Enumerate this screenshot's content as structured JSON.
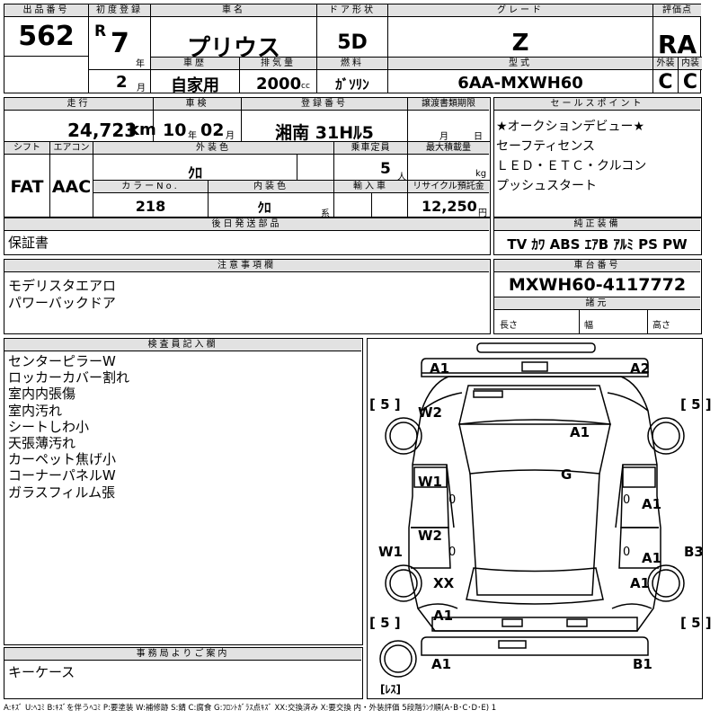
{
  "header": {
    "lot_label": "出品番号",
    "lot_no": "562",
    "first_reg_label": "初度登録",
    "era": "R",
    "year": "7",
    "year_unit": "年",
    "month": "2",
    "month_unit": "月",
    "car_name_label": "車名",
    "car_name": "プリウス",
    "door_label": "ドア形状",
    "door": "5D",
    "grade_label": "グレード",
    "grade": "Z",
    "score_label": "評価点",
    "score": "RA",
    "history_label": "車歴",
    "history": "自家用",
    "displacement_label": "排気量",
    "displacement": "2000",
    "displacement_unit": "cc",
    "fuel_label": "燃料",
    "fuel": "ｶﾞｿﾘﾝ",
    "model_label": "型式",
    "model": "6AA-MXWH60",
    "ext_label": "外装",
    "ext": "C",
    "int_label": "内装",
    "int": "C"
  },
  "row2": {
    "mileage_label": "走行",
    "mileage": "24,723",
    "mileage_unit": "km",
    "inspection_label": "車検",
    "insp_year": "10",
    "insp_year_unit": "年",
    "insp_month": "02",
    "insp_month_unit": "月",
    "reg_no_label": "登録番号",
    "reg_no": "湘南 31Hﾙ5",
    "transfer_label": "譲渡書類期限",
    "transfer_month": "月",
    "transfer_day": "日",
    "shift_label": "シフト",
    "shift": "FAT",
    "ac_label": "エアコン",
    "ac": "AAC",
    "ext_color_label": "外装色",
    "ext_color": "ｸﾛ",
    "capacity_label": "乗車定員",
    "capacity": "5",
    "capacity_unit": "人",
    "load_label": "最大積載量",
    "load_unit": "kg",
    "color_no_label": "カラーNo.",
    "color_no": "218",
    "int_color_label": "内装色",
    "int_color": "ｸﾛ",
    "int_color_unit": "系",
    "import_label": "輸入車",
    "recycle_label": "リサイクル預託金",
    "recycle": "12,250",
    "recycle_unit": "円"
  },
  "sales": {
    "label": "セールスポイント",
    "lines": [
      "★オークションデビュー★",
      "セーフティセンス",
      "ＬＥＤ・ＥＴＣ・クルコン",
      "プッシュスタート"
    ]
  },
  "later_parts": {
    "label": "後日発送部品",
    "text": "保証書"
  },
  "genuine": {
    "label": "純正装備",
    "text": "TV ｶﾜ ABS ｴｱB ｱﾙﾐ PS PW"
  },
  "caution": {
    "label": "注意事項欄",
    "lines": [
      "モデリスタエアロ",
      "パワーバックドア"
    ]
  },
  "chassis": {
    "label": "車台番号",
    "number": "MXWH60-4117772",
    "spec_label": "諸元",
    "length": "長さ",
    "width": "幅",
    "height": "高さ"
  },
  "inspector": {
    "label": "検査員記入欄",
    "lines": [
      "センターピラーW",
      "ロッカーカバー割れ",
      "室内内張傷",
      "室内汚れ",
      "シートしわ小",
      "天張薄汚れ",
      "カーペット焦げ小",
      "コーナーパネルW",
      "ガラスフィルム張"
    ]
  },
  "office": {
    "label": "事務局よりご案内",
    "text": "キーケース"
  },
  "diagram": {
    "marks": {
      "a1_front_left": "A1",
      "a2_front_right": "A2",
      "w2_left_fender": "W2",
      "a1_hood": "A1",
      "g_windshield": "G",
      "w1_front_door": "W1",
      "a1_right_front_door": "A1",
      "w2_rear_door": "W2",
      "a1_right_rear_door": "A1",
      "w1_left_rocker": "W1",
      "b3_right_rocker": "B3",
      "xx_rear_left": "XX",
      "a1_rear_right": "A1",
      "a1_left_quarter": "A1",
      "a1_rear_left": "A1",
      "b1_rear_right": "B1",
      "zero_1": "0",
      "zero_2": "0",
      "zero_3": "0",
      "zero_4": "0"
    },
    "tires": {
      "fl": "[ 5 ]",
      "fr": "[ 5 ]",
      "rl": "[ 5 ]",
      "rr": "[ 5 ]",
      "spare": "[ﾚｽ]"
    }
  },
  "legend": "A:ｷｽﾞ U:ﾍｺﾐ B:ｷｽﾞを伴うﾍｺﾐ P:要塗装 W:補修跡 S:錆 C:腐食 G:ﾌﾛﾝﾄｶﾞﾗｽ点ｷｽﾞ XX:交換済み X:要交換 内・外装評価 5段階ﾗﾝｸ順(A･B･C･D･E) 1"
}
